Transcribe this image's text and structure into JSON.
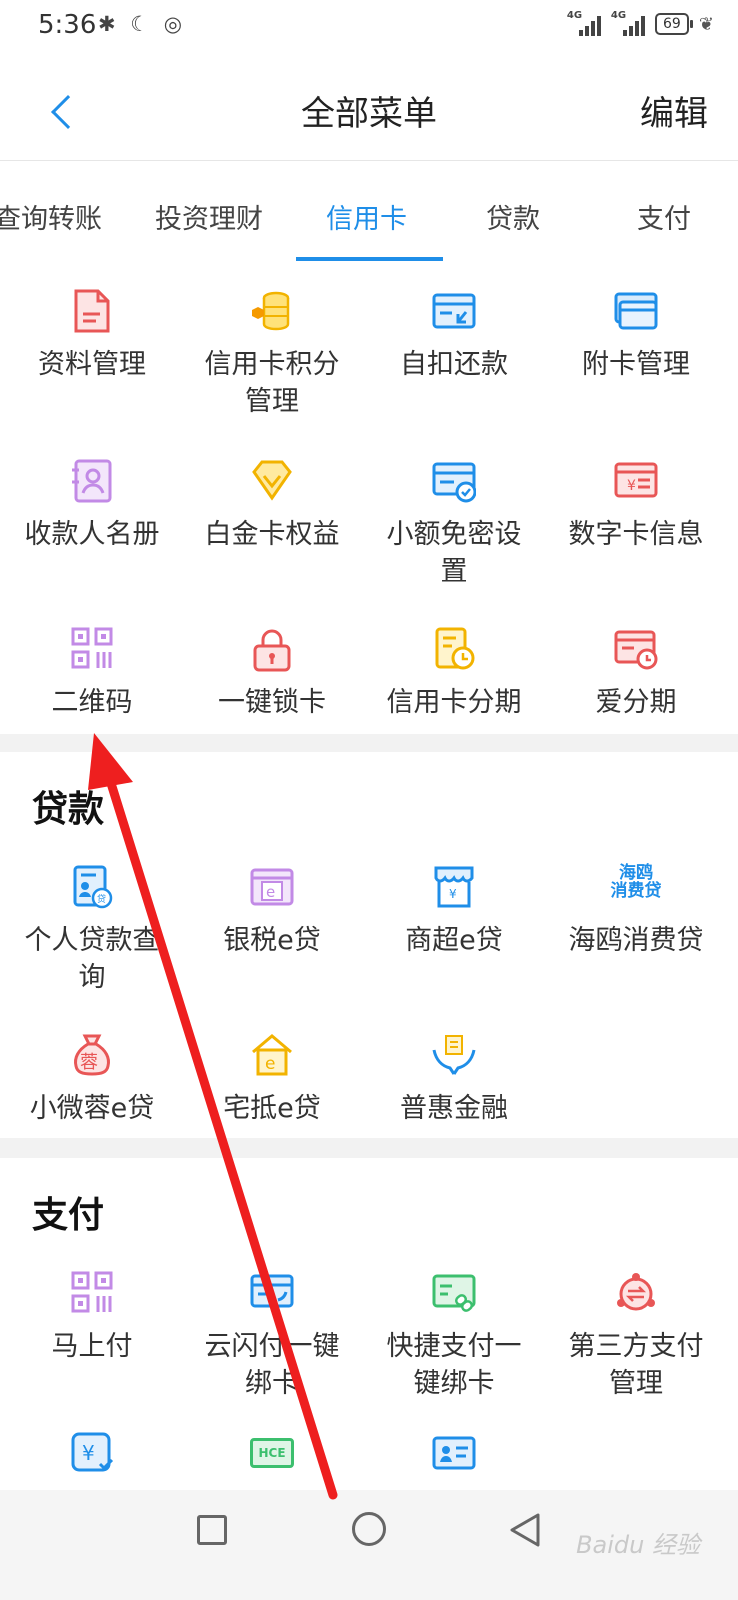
{
  "status_bar": {
    "time": "5:36",
    "left_icons": "✱ ☾ ◎",
    "signal1_label": "4G",
    "signal2_label": "4G",
    "battery": "69",
    "leaf": "❦"
  },
  "header": {
    "title": "全部菜单",
    "edit": "编辑"
  },
  "tabs": [
    {
      "label": "查询转账"
    },
    {
      "label": "投资理财"
    },
    {
      "label": "信用卡"
    },
    {
      "label": "贷款"
    },
    {
      "label": "支付"
    }
  ],
  "active_tab": "信用卡",
  "credit_card": {
    "items": [
      {
        "label": "资料管理",
        "icon": "document-icon"
      },
      {
        "label": "信用卡积分\n管理",
        "icon": "coins-icon"
      },
      {
        "label": "自扣还款",
        "icon": "card-return-icon"
      },
      {
        "label": "附卡管理",
        "icon": "cards-icon"
      },
      {
        "label": "收款人名册",
        "icon": "contact-book-icon"
      },
      {
        "label": "白金卡权益",
        "icon": "diamond-icon"
      },
      {
        "label": "小额免密设\n置",
        "icon": "card-check-icon"
      },
      {
        "label": "数字卡信息",
        "icon": "yuan-card-icon"
      },
      {
        "label": "二维码",
        "icon": "qr-code-icon"
      },
      {
        "label": "一键锁卡",
        "icon": "lock-icon"
      },
      {
        "label": "信用卡分期",
        "icon": "clock-document-icon"
      },
      {
        "label": "爱分期",
        "icon": "card-clock-icon"
      }
    ]
  },
  "loan": {
    "title": "贷款",
    "items": [
      {
        "label": "个人贷款查\n询",
        "icon": "loan-document-icon"
      },
      {
        "label": "银税e贷",
        "icon": "e-card-icon"
      },
      {
        "label": "商超e贷",
        "icon": "store-icon"
      },
      {
        "label": "海鸥消费贷",
        "icon": "haiou-logo-icon",
        "logo_text": "海鸥\n消费贷"
      },
      {
        "label": "小微蓉e贷",
        "icon": "money-bag-icon",
        "logo_text": "蓉"
      },
      {
        "label": "宅抵e贷",
        "icon": "house-icon"
      },
      {
        "label": "普惠金融",
        "icon": "hands-icon"
      }
    ]
  },
  "pay": {
    "title": "支付",
    "items": [
      {
        "label": "马上付",
        "icon": "qr-code-icon"
      },
      {
        "label": "云闪付一键\n绑卡",
        "icon": "card-link-icon"
      },
      {
        "label": "快捷支付一\n键绑卡",
        "icon": "card-chain-icon"
      },
      {
        "label": "第三方支付\n管理",
        "icon": "exchange-icon"
      },
      {
        "label": "",
        "icon": "yuan-check-icon"
      },
      {
        "label": "",
        "icon": "hce-card-icon",
        "logo_text": "HCE"
      },
      {
        "label": "",
        "icon": "id-card-icon"
      }
    ]
  },
  "watermark": "Baidu 经验",
  "colors": {
    "accent": "#1f8ee8",
    "arrow": "#ee1f1f"
  }
}
